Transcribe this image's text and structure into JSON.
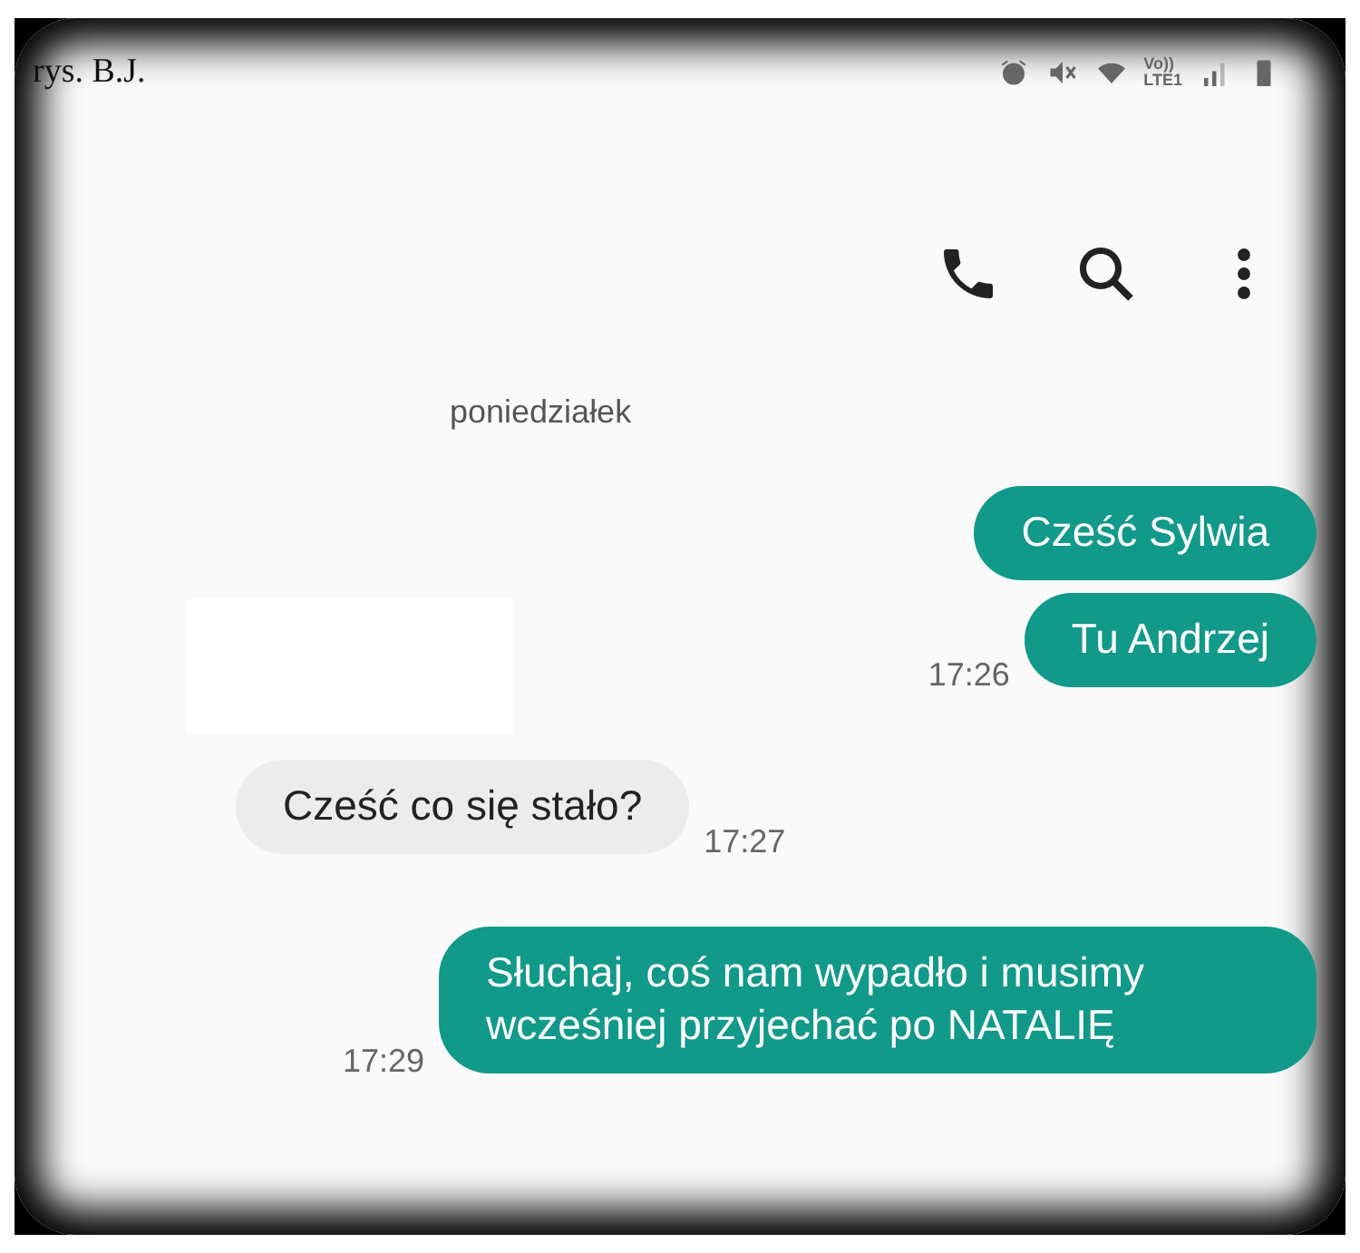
{
  "caption": "rys. B.J.",
  "status_bar": {
    "network_top": "Vo))",
    "network_bottom": "LTE1"
  },
  "date_label": "poniedziałek",
  "messages": [
    {
      "kind": "outgoing",
      "text": "Cześć Sylwia"
    },
    {
      "kind": "outgoing",
      "text": "Tu Andrzej",
      "time": "17:26"
    },
    {
      "kind": "incoming",
      "text": "Cześć co się stało?",
      "time": "17:27"
    },
    {
      "kind": "outgoing",
      "text": "Słuchaj, coś nam wypadło i musimy wcześniej przyjechać po NATALIĘ",
      "time": "17:29"
    }
  ]
}
